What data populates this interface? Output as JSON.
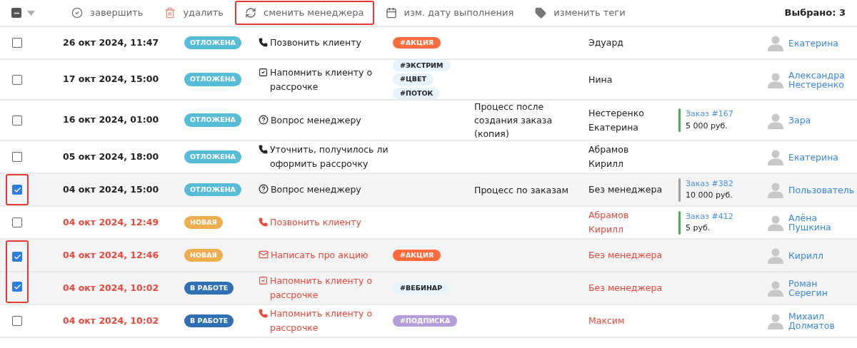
{
  "toolbar": {
    "select_all": {
      "indeterminate": true
    },
    "actions": [
      {
        "kind": "complete",
        "label": "завершить",
        "highlighted": false
      },
      {
        "kind": "delete",
        "label": "удалить",
        "highlighted": false
      },
      {
        "kind": "change-manager",
        "label": "сменить менеджера",
        "highlighted": true
      },
      {
        "kind": "date",
        "label": "изм. дату выполнения",
        "highlighted": false
      },
      {
        "kind": "tags",
        "label": "изменить теги",
        "highlighted": false
      }
    ],
    "selected_count": "Выбрано: 3"
  },
  "rows": [
    {
      "checked": false,
      "highlighted": false,
      "overdue": false,
      "date": "26 окт 2024, 11:47",
      "status": {
        "label": "ОТЛОЖЕНА",
        "color": "#56bcd8"
      },
      "task": {
        "kind": "call",
        "text": "Позвонить клиенту"
      },
      "tags": [
        {
          "label": "#АКЦИЯ",
          "color": "#ff6b3d"
        }
      ],
      "client": [
        "Эдуард"
      ],
      "manager": [
        "Екатерина"
      ]
    },
    {
      "checked": false,
      "highlighted": false,
      "overdue": false,
      "date": "17 окт 2024, 15:00",
      "status": {
        "label": "ОТЛОЖЕНА",
        "color": "#56bcd8"
      },
      "task": {
        "kind": "reminder",
        "text": "Напомнить клиенту о рассрочке"
      },
      "tags": [
        {
          "label": "#ЭКСТРИМ",
          "color": "#e6f2fc"
        },
        {
          "label": "#ЦВЕТ",
          "color": "#e6f2fc"
        },
        {
          "label": "#ПОТОК",
          "color": "#e6f2fc"
        }
      ],
      "client": [
        "Нина"
      ],
      "manager": [
        "Александра",
        "Нестеренко"
      ]
    },
    {
      "checked": false,
      "highlighted": false,
      "overdue": false,
      "date": "16 окт 2024, 01:00",
      "status": {
        "label": "ОТЛОЖЕНА",
        "color": "#56bcd8"
      },
      "task": {
        "kind": "question",
        "text": "Вопрос менеджеру"
      },
      "process": "Процесс после создания заказа (копия)",
      "client": [
        "Нестеренко",
        "Екатерина"
      ],
      "order": {
        "link": "Заказ #167",
        "sum": "5 000 руб.",
        "color": "#4caf50"
      },
      "manager": [
        "Зара"
      ]
    },
    {
      "checked": false,
      "highlighted": false,
      "overdue": false,
      "date": "05 окт 2024, 18:00",
      "status": {
        "label": "ОТЛОЖЕНА",
        "color": "#56bcd8"
      },
      "task": {
        "kind": "call",
        "text": "Уточнить, получилось ли оформить рассрочку"
      },
      "client": [
        "Абрамов",
        "Кирилл"
      ],
      "manager": [
        "Екатерина"
      ]
    },
    {
      "checked": true,
      "highlighted": true,
      "overdue": false,
      "date": "04 окт 2024, 15:00",
      "status": {
        "label": "ОТЛОЖЕНА",
        "color": "#56bcd8"
      },
      "task": {
        "kind": "question",
        "text": "Вопрос менеджеру"
      },
      "process": "Процесс по заказам",
      "client": [
        "Без менеджера"
      ],
      "order": {
        "link": "Заказ #382",
        "sum": "10 000 руб.",
        "color": "#9e9e9e"
      },
      "manager": [
        "Пользователь"
      ]
    },
    {
      "checked": false,
      "highlighted": false,
      "overdue": true,
      "date": "04 окт 2024, 12:49",
      "status": {
        "label": "НОВАЯ",
        "color": "#f0ad4e"
      },
      "task": {
        "kind": "call",
        "text": "Позвонить клиенту"
      },
      "client": [
        "Абрамов",
        "Кирилл"
      ],
      "order": {
        "link": "Заказ #412",
        "sum": "5 руб.",
        "color": "#4caf50"
      },
      "manager": [
        "Алёна",
        "Пушкина"
      ]
    },
    {
      "checked": true,
      "highlighted": true,
      "overdue": true,
      "date": "04 окт 2024, 12:46",
      "status": {
        "label": "НОВАЯ",
        "color": "#f0ad4e"
      },
      "task": {
        "kind": "mail",
        "text": "Написать про акцию"
      },
      "tags": [
        {
          "label": "#АКЦИЯ",
          "color": "#ff6b3d"
        }
      ],
      "client": [
        "Без менеджера"
      ],
      "manager": [
        "Кирилл"
      ]
    },
    {
      "checked": true,
      "highlighted": true,
      "overdue": true,
      "date": "04 окт 2024, 10:02",
      "status": {
        "label": "В РАБОТЕ",
        "color": "#2f6fb4"
      },
      "task": {
        "kind": "reminder",
        "text": "Напомнить клиенту о рассрочке"
      },
      "tags": [
        {
          "label": "#ВЕБИНАР",
          "color": "#e6f2fc"
        }
      ],
      "client": [
        "Без менеджера"
      ],
      "manager": [
        "Роман",
        "Серегин"
      ]
    },
    {
      "checked": false,
      "highlighted": false,
      "overdue": true,
      "date": "04 окт 2024, 10:02",
      "status": {
        "label": "В РАБОТЕ",
        "color": "#2f6fb4"
      },
      "task": {
        "kind": "call",
        "text": "Напомнить клиенту о рассрочке"
      },
      "tags": [
        {
          "label": "#ПОДПИСКА",
          "color": "#b39ddb"
        }
      ],
      "client": [
        "Максим"
      ],
      "manager": [
        "Михаил",
        "Долматов"
      ]
    }
  ]
}
